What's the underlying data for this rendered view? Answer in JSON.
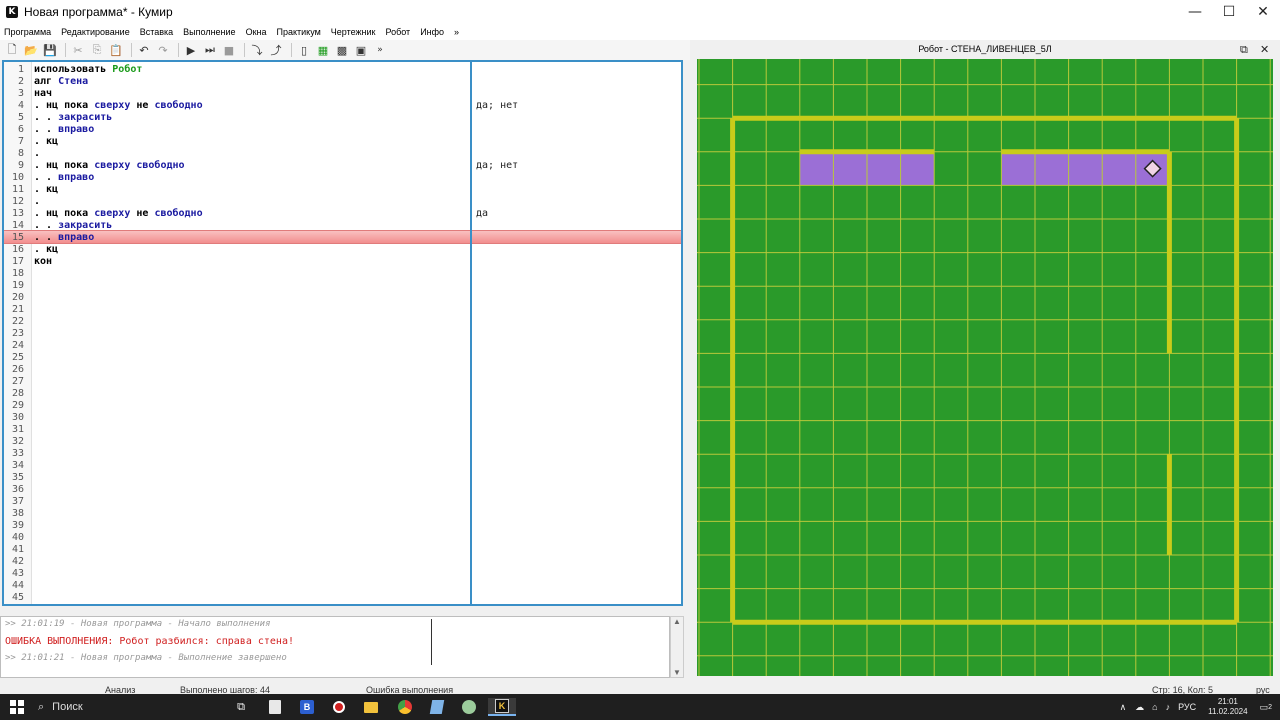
{
  "window": {
    "title": "Новая программа* - Кумир",
    "app_icon_letter": "K",
    "minimize": "—",
    "maximize": "☐",
    "close": "✕"
  },
  "menu": {
    "items": [
      "Программа",
      "Редактирование",
      "Вставка",
      "Выполнение",
      "Окна",
      "Практикум",
      "Чертежник",
      "Робот",
      "Инфо",
      "»"
    ]
  },
  "toolbar": {
    "more": "»"
  },
  "editor": {
    "lines": [
      {
        "n": "1",
        "parts": [
          {
            "t": "использовать ",
            "c": ""
          },
          {
            "t": "Робот",
            "c": "green"
          }
        ],
        "margin": ""
      },
      {
        "n": "2",
        "parts": [
          {
            "t": "алг ",
            "c": ""
          },
          {
            "t": "Стена",
            "c": "blue"
          }
        ],
        "margin": ""
      },
      {
        "n": "3",
        "parts": [
          {
            "t": "нач",
            "c": ""
          }
        ],
        "margin": ""
      },
      {
        "n": "4",
        "parts": [
          {
            "t": ". нц пока ",
            "c": ""
          },
          {
            "t": "сверху",
            "c": "blue"
          },
          {
            "t": " не ",
            "c": ""
          },
          {
            "t": "свободно",
            "c": "blue"
          }
        ],
        "margin": "да; нет"
      },
      {
        "n": "5",
        "parts": [
          {
            "t": ". . ",
            "c": ""
          },
          {
            "t": "закрасить",
            "c": "blue"
          }
        ],
        "margin": ""
      },
      {
        "n": "6",
        "parts": [
          {
            "t": ". . ",
            "c": ""
          },
          {
            "t": "вправо",
            "c": "blue"
          }
        ],
        "margin": ""
      },
      {
        "n": "7",
        "parts": [
          {
            "t": ". кц",
            "c": ""
          }
        ],
        "margin": ""
      },
      {
        "n": "8",
        "parts": [
          {
            "t": ".",
            "c": ""
          }
        ],
        "margin": ""
      },
      {
        "n": "9",
        "parts": [
          {
            "t": ". нц пока ",
            "c": ""
          },
          {
            "t": "сверху",
            "c": "blue"
          },
          {
            "t": " ",
            "c": ""
          },
          {
            "t": "свободно",
            "c": "blue"
          }
        ],
        "margin": "да; нет"
      },
      {
        "n": "10",
        "parts": [
          {
            "t": ". . ",
            "c": ""
          },
          {
            "t": "вправо",
            "c": "blue"
          }
        ],
        "margin": ""
      },
      {
        "n": "11",
        "parts": [
          {
            "t": ". кц",
            "c": ""
          }
        ],
        "margin": ""
      },
      {
        "n": "12",
        "parts": [
          {
            "t": ".",
            "c": ""
          }
        ],
        "margin": ""
      },
      {
        "n": "13",
        "parts": [
          {
            "t": ". нц пока ",
            "c": ""
          },
          {
            "t": "сверху",
            "c": "blue"
          },
          {
            "t": " не ",
            "c": ""
          },
          {
            "t": "свободно",
            "c": "blue"
          }
        ],
        "margin": "да"
      },
      {
        "n": "14",
        "parts": [
          {
            "t": ". . ",
            "c": ""
          },
          {
            "t": "закрасить",
            "c": "blue"
          }
        ],
        "margin": ""
      },
      {
        "n": "15",
        "parts": [
          {
            "t": ". . ",
            "c": ""
          },
          {
            "t": "вправо",
            "c": "blue"
          }
        ],
        "margin": ""
      },
      {
        "n": "16",
        "parts": [
          {
            "t": ". кц",
            "c": ""
          }
        ],
        "margin": ""
      },
      {
        "n": "17",
        "parts": [
          {
            "t": "кон",
            "c": ""
          }
        ],
        "margin": ""
      },
      {
        "n": "18",
        "parts": [],
        "margin": ""
      },
      {
        "n": "19",
        "parts": [],
        "margin": ""
      },
      {
        "n": "20",
        "parts": [],
        "margin": ""
      },
      {
        "n": "21",
        "parts": [],
        "margin": ""
      },
      {
        "n": "22",
        "parts": [],
        "margin": ""
      },
      {
        "n": "23",
        "parts": [],
        "margin": ""
      },
      {
        "n": "24",
        "parts": [],
        "margin": ""
      },
      {
        "n": "25",
        "parts": [],
        "margin": ""
      },
      {
        "n": "26",
        "parts": [],
        "margin": ""
      },
      {
        "n": "27",
        "parts": [],
        "margin": ""
      },
      {
        "n": "28",
        "parts": [],
        "margin": ""
      },
      {
        "n": "29",
        "parts": [],
        "margin": ""
      },
      {
        "n": "30",
        "parts": [],
        "margin": ""
      },
      {
        "n": "31",
        "parts": [],
        "margin": ""
      },
      {
        "n": "32",
        "parts": [],
        "margin": ""
      },
      {
        "n": "33",
        "parts": [],
        "margin": ""
      },
      {
        "n": "34",
        "parts": [],
        "margin": ""
      },
      {
        "n": "35",
        "parts": [],
        "margin": ""
      },
      {
        "n": "36",
        "parts": [],
        "margin": ""
      },
      {
        "n": "37",
        "parts": [],
        "margin": ""
      },
      {
        "n": "38",
        "parts": [],
        "margin": ""
      },
      {
        "n": "39",
        "parts": [],
        "margin": ""
      },
      {
        "n": "40",
        "parts": [],
        "margin": ""
      },
      {
        "n": "41",
        "parts": [],
        "margin": ""
      },
      {
        "n": "42",
        "parts": [],
        "margin": ""
      },
      {
        "n": "43",
        "parts": [],
        "margin": ""
      },
      {
        "n": "44",
        "parts": [],
        "margin": ""
      },
      {
        "n": "45",
        "parts": [],
        "margin": ""
      }
    ],
    "error_line": 15
  },
  "console": {
    "line1": ">> 21:01:19 - Новая программа - Начало выполнения",
    "line2": "ОШИБКА ВЫПОЛНЕНИЯ: Робот разбился: справа стена!",
    "line3": ">> 21:01:21 - Новая программа - Выполнение завершено",
    "scroll_up": "▲",
    "scroll_down": "▼"
  },
  "status": {
    "analysis": "Анализ",
    "steps": "Выполнено шагов: 44",
    "error": "Ошибка выполнения",
    "position": "Стр: 16, Кол: 5",
    "lang": "рус"
  },
  "robot": {
    "title": "Робот  - СТЕНА_ЛИВЕНЦЕВ_5Л",
    "restore": "⧉",
    "close": "✕",
    "colors": {
      "field": "#2a9a2a",
      "grid": "#b8c83a",
      "wall": "#c8cc1a",
      "painted": "#9b6fd6"
    },
    "cols": 17,
    "rows": 18,
    "painted_cells": [
      [
        3,
        3
      ],
      [
        4,
        3
      ],
      [
        5,
        3
      ],
      [
        6,
        3
      ],
      [
        9,
        3
      ],
      [
        10,
        3
      ],
      [
        11,
        3
      ],
      [
        12,
        3
      ],
      [
        13,
        3
      ]
    ],
    "robot_cell": [
      13,
      3
    ],
    "walls": [
      {
        "type": "h",
        "row": 2,
        "from": 1,
        "to": 16
      },
      {
        "type": "h",
        "row": 17,
        "from": 1,
        "to": 16
      },
      {
        "type": "v",
        "col": 1,
        "from": 2,
        "to": 17
      },
      {
        "type": "v",
        "col": 16,
        "from": 2,
        "to": 17
      },
      {
        "type": "h",
        "row": 3,
        "from": 3,
        "to": 7
      },
      {
        "type": "h",
        "row": 3,
        "from": 9,
        "to": 14
      },
      {
        "type": "v",
        "col": 14,
        "from": 3,
        "to": 9
      },
      {
        "type": "v",
        "col": 14,
        "from": 12,
        "to": 15
      }
    ]
  },
  "taskbar": {
    "search": "Поиск",
    "lang": "РУС",
    "time": "21:01",
    "date": "11.02.2024",
    "notifications": "2"
  }
}
